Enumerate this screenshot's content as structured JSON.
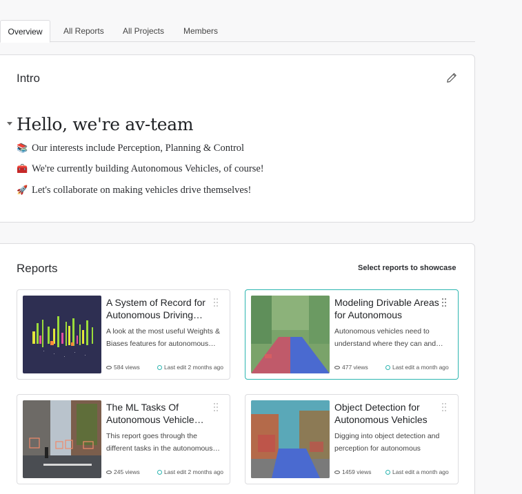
{
  "tabs": [
    {
      "label": "Overview",
      "active": true
    },
    {
      "label": "All Reports",
      "active": false
    },
    {
      "label": "All Projects",
      "active": false
    },
    {
      "label": "Members",
      "active": false
    }
  ],
  "intro": {
    "title": "Intro",
    "edit_icon": "pencil-icon",
    "heading": "Hello, we're av-team",
    "lines": [
      {
        "emoji": "📚",
        "text": "Our interests include Perception, Planning & Control"
      },
      {
        "emoji": "🧰",
        "text": "We're currently building Autonomous Vehicles, of course!"
      },
      {
        "emoji": "🚀",
        "text": "Let's collaborate on making vehicles drive themselves!"
      }
    ]
  },
  "reports": {
    "title": "Reports",
    "showcase_label": "Select reports to showcase",
    "cards": [
      {
        "title": "A System of Record for Autonomous Driving…",
        "description": "A look at the most useful Weights & Biases features for autonomous…",
        "views": "584 views",
        "edit": "Last edit 2 months ago"
      },
      {
        "title": "Modeling Drivable Areas for Autonomous Vehicle…",
        "description": "Autonomous vehicles need to understand where they can and…",
        "views": "477 views",
        "edit": "Last edit a month ago"
      },
      {
        "title": "The ML Tasks Of Autonomous Vehicle…",
        "description": "This report goes through the different tasks in the autonomous…",
        "views": "245 views",
        "edit": "Last edit 2 months ago"
      },
      {
        "title": "Object Detection for Autonomous Vehicles (A…",
        "description": "Digging into object detection and perception for autonomous vehicl…",
        "views": "1459 views",
        "edit": "Last edit a month ago"
      }
    ]
  },
  "colors": {
    "accent": "#2bb5b0",
    "border": "#dcdcdf",
    "background": "#f8f8f9"
  }
}
